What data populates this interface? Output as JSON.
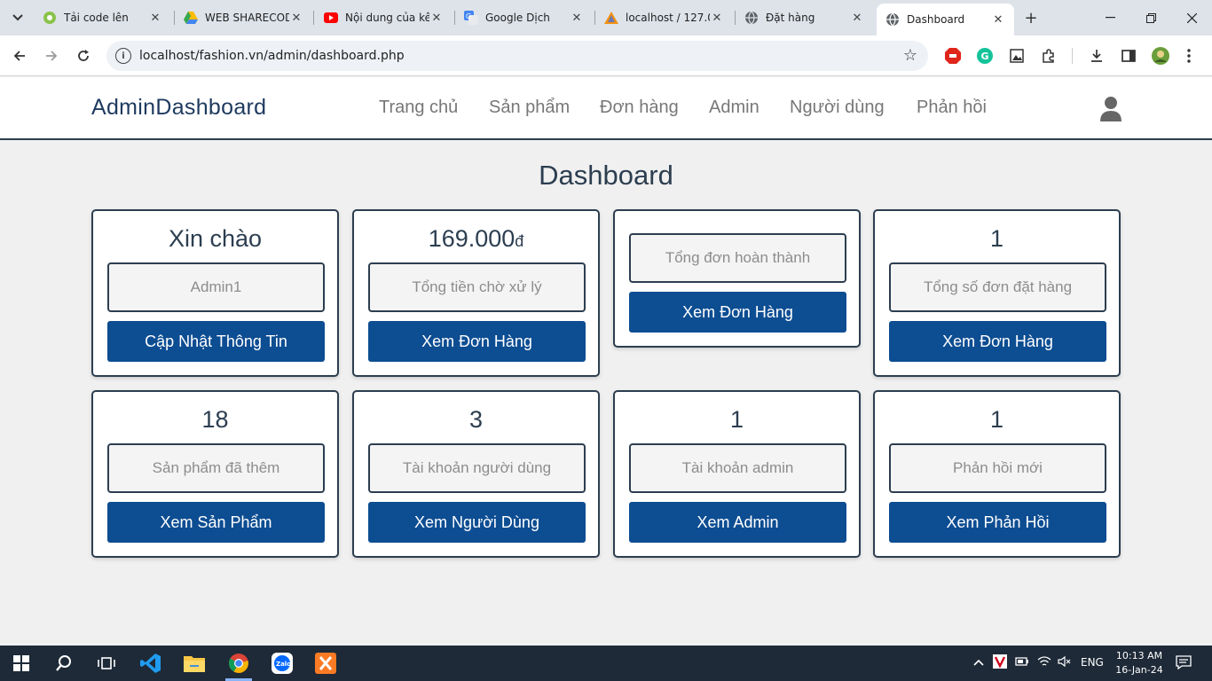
{
  "browser": {
    "tabs": [
      {
        "title": "Tải code lên",
        "icon": "sharecode-icon"
      },
      {
        "title": "WEB SHARECODE",
        "icon": "google-drive-icon"
      },
      {
        "title": "Nội dung của kê",
        "icon": "youtube-icon"
      },
      {
        "title": "Google Dịch",
        "icon": "google-translate-icon"
      },
      {
        "title": "localhost / 127.0",
        "icon": "phpmyadmin-icon"
      },
      {
        "title": "Đặt hàng",
        "icon": "globe-icon"
      },
      {
        "title": "Dashboard",
        "icon": "globe-icon",
        "active": true
      }
    ],
    "url": "localhost/fashion.vn/admin/dashboard.php"
  },
  "header": {
    "brand": "AdminDashboard",
    "nav": [
      "Trang chủ",
      "Sản phẩm",
      "Đơn hàng",
      "Admin",
      "Người dùng",
      "Phản hồi"
    ]
  },
  "page": {
    "title": "Dashboard",
    "cards": [
      {
        "value": "Xin chào",
        "label": "Admin1",
        "button": "Cập Nhật Thông Tin"
      },
      {
        "value": "169.000",
        "currency": "đ",
        "label": "Tổng tiền chờ xử lý",
        "button": "Xem Đơn Hàng"
      },
      {
        "value": "",
        "label": "Tổng đơn hoàn thành",
        "button": "Xem Đơn Hàng"
      },
      {
        "value": "1",
        "label": "Tổng số đơn đặt hàng",
        "button": "Xem Đơn Hàng"
      },
      {
        "value": "18",
        "label": "Sản phẩm đã thêm",
        "button": "Xem Sản Phẩm"
      },
      {
        "value": "3",
        "label": "Tài khoản người dùng",
        "button": "Xem Người Dùng"
      },
      {
        "value": "1",
        "label": "Tài khoản admin",
        "button": "Xem Admin"
      },
      {
        "value": "1",
        "label": "Phản hồi mới",
        "button": "Xem Phản Hồi"
      }
    ]
  },
  "taskbar": {
    "language": "ENG",
    "time": "10:13 AM",
    "date": "16-Jan-24"
  },
  "colors": {
    "primary": "#0d4d92",
    "dark": "#2c3e50",
    "background": "#f0f0f0"
  }
}
